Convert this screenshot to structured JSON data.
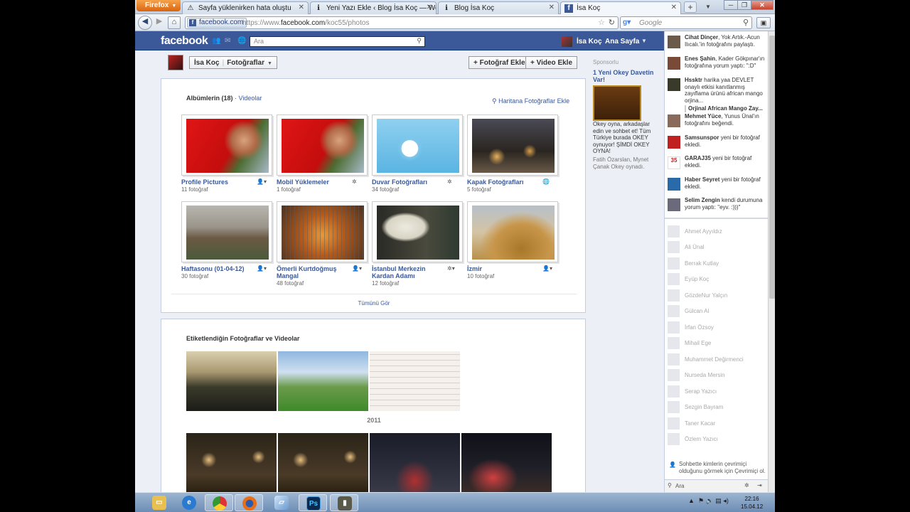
{
  "browser": {
    "app_button": "Firefox",
    "tabs": [
      {
        "label": "Sayfa yüklenirken hata oluştu",
        "icon": "warning-icon"
      },
      {
        "label": "Yeni Yazı Ekle ‹ Blog İsa Koç — Word...",
        "icon": "info-icon"
      },
      {
        "label": "Blog İsa Koç",
        "icon": "info-icon"
      },
      {
        "label": "İsa Koç",
        "icon": "facebook-icon"
      }
    ],
    "identity": "facebook.com",
    "url_prefix": "https://www.",
    "url_domain": "facebook.com",
    "url_path": "/koc55/photos",
    "search_placeholder": "Google"
  },
  "facebook": {
    "logo": "facebook",
    "search_placeholder": "Ara",
    "user_name": "İsa Koç",
    "home_label": "Ana Sayfa"
  },
  "page_header": {
    "name": "İsa Koç",
    "section": "Fotoğraflar",
    "add_photo": "+ Fotoğraf Ekle",
    "add_video": "+ Video Ekle"
  },
  "albums_section": {
    "title": "Albümlerin (18)",
    "videos_link": "· Videolar",
    "map_link": "Haritana Fotoğraflar Ekle",
    "see_all": "Tümünü Gör",
    "albums": [
      {
        "title": "Profile Pictures",
        "count": "11 fotoğraf",
        "privacy": "friends-icon"
      },
      {
        "title": "Mobil Yüklemeler",
        "count": "1 fotoğraf",
        "privacy": "gear-icon"
      },
      {
        "title": "Duvar Fotoğrafları",
        "count": "34 fotoğraf",
        "privacy": "gear-icon"
      },
      {
        "title": "Kapak Fotoğrafları",
        "count": "5 fotoğraf",
        "privacy": "globe-icon"
      },
      {
        "title": "Haftasonu (01-04-12)",
        "count": "30 fotoğraf",
        "privacy": "friends-icon"
      },
      {
        "title": "Ömerli Kurtdoğmuş Mangal",
        "count": "48 fotoğraf",
        "privacy": "friends-icon"
      },
      {
        "title": "İstanbul Merkezin Kardan Adamı",
        "count": "12 fotoğraf",
        "privacy": "gear-icon"
      },
      {
        "title": "İzmir",
        "count": "10 fotoğraf",
        "privacy": "friends-icon"
      }
    ]
  },
  "tagged_section": {
    "title": "Etiketlendiğin Fotoğraflar ve Videolar",
    "year": "2011"
  },
  "ads": {
    "label": "Sponsorlu",
    "title": "1 Yeni Okey Davetin Var!",
    "text": "Okey oyna, arkadaşlar edin ve sohbet et! Tüm Türkiye burada OKEY oynuyor! ŞİMDİ OKEY OYNA!",
    "footer": "Fatih Özarslan, Mynet Çanak Okey oynadı."
  },
  "ticker": [
    {
      "name": "Cihat Dinçer",
      "text": ", Yok Artık.-Acun Ilıcalı.'in fotoğrafını paylaştı."
    },
    {
      "name": "Enes Şahin",
      "text": ", Kader Gökpınar'ın fotoğrafına yorum yaptı: \":D\""
    },
    {
      "name": "Hssktr",
      "text": " harika yaa DEVLET onaylı etkisi kanıtlanmış zayıflama ürünü african mango orjina...",
      "sub": "Orjinal African Mango Zay..."
    },
    {
      "name": "Mehmet Yüce",
      "text": ", Yunus Ünal'ın fotoğrafını beğendi."
    },
    {
      "name": "Samsunspor",
      "text": " yeni bir fotoğraf ekledi."
    },
    {
      "name": "GARAJ35",
      "text": " yeni bir fotoğraf ekledi."
    },
    {
      "name": "Haber Seyret",
      "text": " yeni bir fotoğraf ekledi."
    },
    {
      "name": "Selim Zengin",
      "text": " kendi durumuna yorum yaptı: \"eyv. :)))\""
    }
  ],
  "chat_friends": [
    "Ahmet Ayyıldız",
    "Ali Ünal",
    "Berrak Kutlay",
    "Eyüp Koç",
    "GözdeNur Yalçın",
    "Gülcan Al",
    "İrfan Özsoy",
    "Mihail Ege",
    "Muhammet Değirmenci",
    "Nurseda Mersin",
    "Serap Yazıcı",
    "Sezgin Bayram",
    "Taner Kacar",
    "Özlem Yazıcı"
  ],
  "chat": {
    "note": "Sohbette kimlerin çevrimiçi olduğunu görmek için Çevrimiçi ol.",
    "search_placeholder": "Ara"
  },
  "taskbar": {
    "clock_time": "22:16",
    "clock_date": "15.04.12"
  },
  "colors": {
    "facebook_blue": "#3b5998",
    "link": "#3b5998",
    "firefox_orange": "#e76f1a"
  }
}
